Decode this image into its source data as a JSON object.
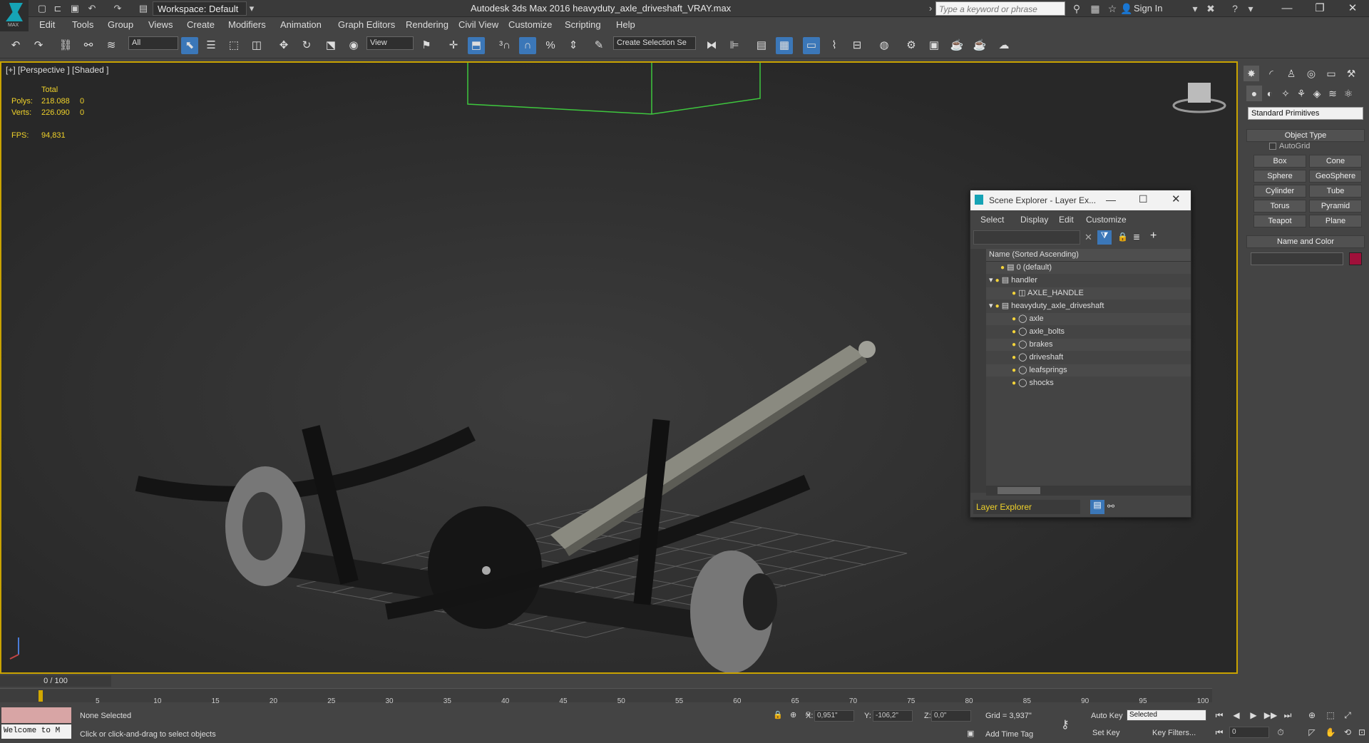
{
  "app": {
    "logo_text": "MAX",
    "workspace": "Workspace: Default",
    "title": "Autodesk 3ds Max 2016    heavyduty_axle_driveshaft_VRAY.max",
    "search_placeholder": "Type a keyword or phrase",
    "sign_in": "Sign In"
  },
  "menus": [
    "Edit",
    "Tools",
    "Group",
    "Views",
    "Create",
    "Modifiers",
    "Animation",
    "Graph Editors",
    "Rendering",
    "Civil View",
    "Customize",
    "Scripting",
    "Help"
  ],
  "toolbar": {
    "selection_filter": "All",
    "reference_coord": "View",
    "named_selection": "Create Selection Se"
  },
  "viewport": {
    "label": "[+] [Perspective ] [Shaded ]",
    "stats_header": "Total",
    "polys_label": "Polys:",
    "polys_value": "218.088",
    "polys_sel": "0",
    "verts_label": "Verts:",
    "verts_value": "226.090",
    "verts_sel": "0",
    "fps_label": "FPS:",
    "fps_value": "94,831"
  },
  "command_panel": {
    "dropdown": "Standard Primitives",
    "object_type": "Object Type",
    "autogrid": "AutoGrid",
    "buttons": [
      "Box",
      "Cone",
      "Sphere",
      "GeoSphere",
      "Cylinder",
      "Tube",
      "Torus",
      "Pyramid",
      "Teapot",
      "Plane"
    ],
    "name_and_color": "Name and Color",
    "object_color": "#a0103a"
  },
  "scene_explorer": {
    "title": "Scene Explorer - Layer Ex...",
    "menus": [
      "Select",
      "Display",
      "Edit",
      "Customize"
    ],
    "column_header": "Name (Sorted Ascending)",
    "rows": [
      "0 (default)",
      "handler",
      "AXLE_HANDLE",
      "heavyduty_axle_driveshaft",
      "axle",
      "axle_bolts",
      "brakes",
      "driveshaft",
      "leafsprings",
      "shocks"
    ],
    "footer_dropdown": "Layer Explorer"
  },
  "timeline": {
    "frame_counter": "0 / 100",
    "ticks": [
      "5",
      "10",
      "15",
      "20",
      "25",
      "30",
      "35",
      "40",
      "45",
      "50",
      "55",
      "60",
      "65",
      "70",
      "75",
      "80",
      "85",
      "90",
      "95",
      "100"
    ]
  },
  "status": {
    "maxscript": "Welcome to M",
    "selection": "None Selected",
    "prompt": "Click or click-and-drag to select objects",
    "x_label": "X:",
    "x_value": "0,951\"",
    "y_label": "Y:",
    "y_value": "-106,2\"",
    "z_label": "Z:",
    "z_value": "0,0\"",
    "grid": "Grid = 3,937\"",
    "add_time_tag": "Add Time Tag",
    "auto_key": "Auto Key",
    "key_mode": "Selected",
    "set_key": "Set Key",
    "key_filters": "Key Filters...",
    "frame_field": "0"
  }
}
